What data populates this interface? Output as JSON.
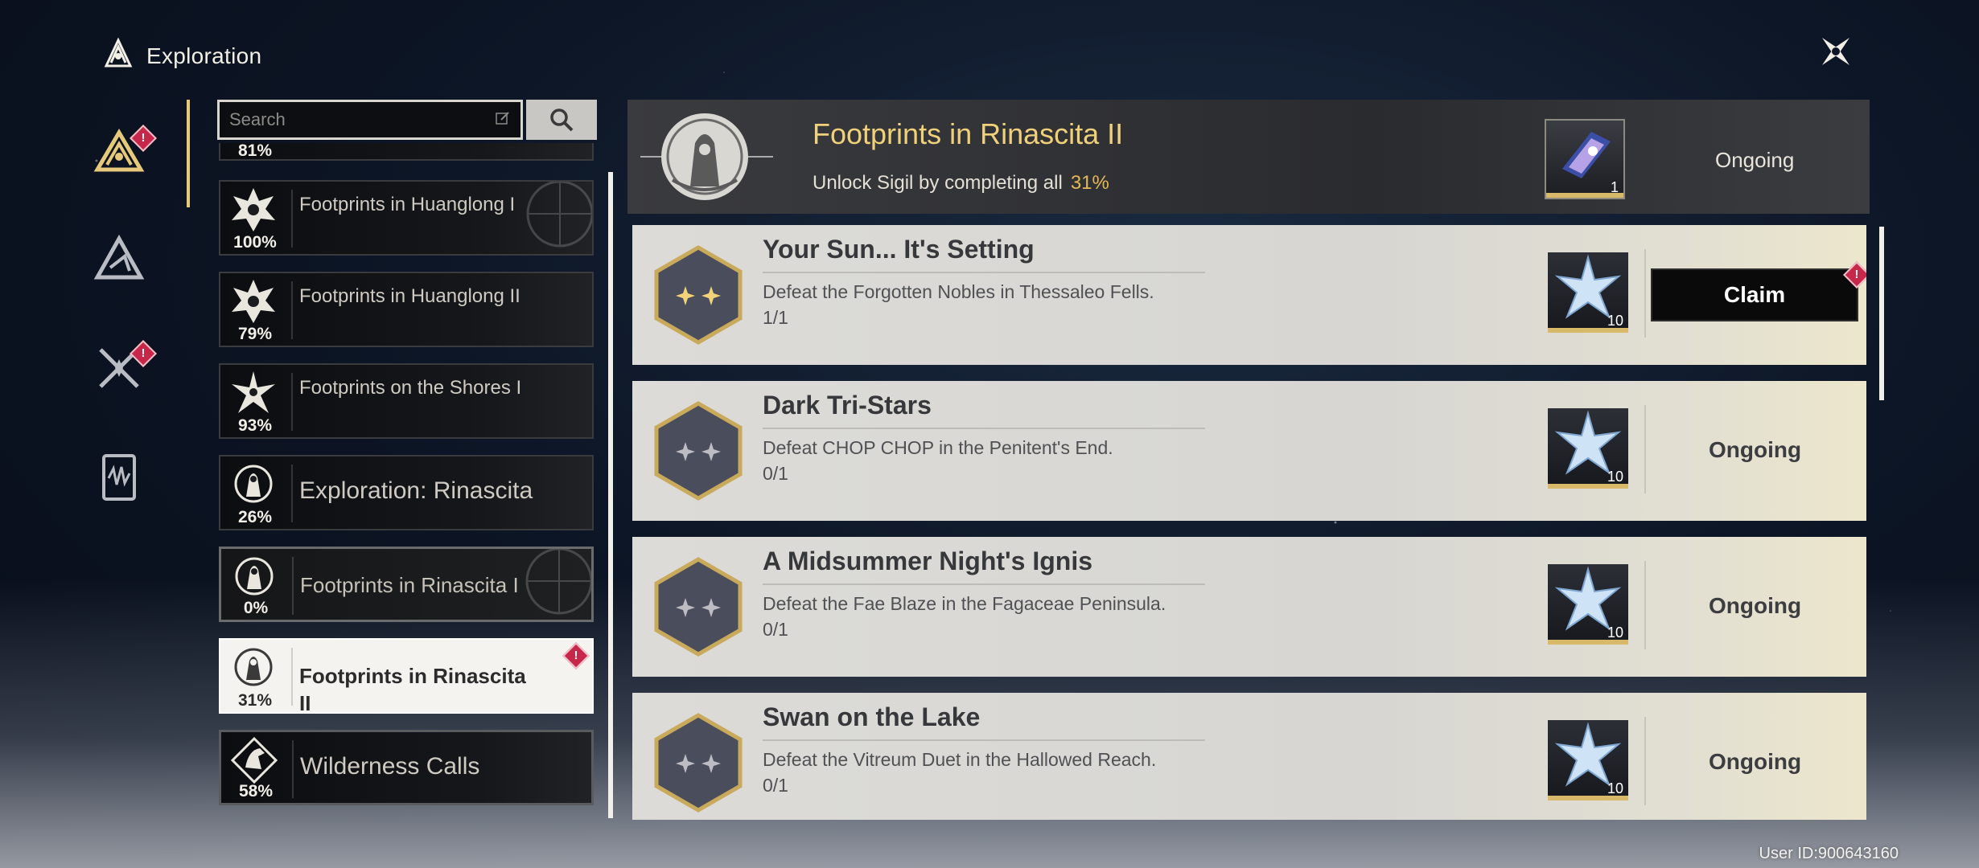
{
  "header": {
    "title": "Exploration",
    "logo_icon": "exploration-logo-icon",
    "close_icon": "close-icon"
  },
  "rail": {
    "items": [
      {
        "name": "exploration-tab",
        "icon": "exploration-icon",
        "active": true,
        "badge": "!"
      },
      {
        "name": "mountain-tab",
        "icon": "peak-icon",
        "active": false,
        "badge": ""
      },
      {
        "name": "battle-tab",
        "icon": "crossed-swords-icon",
        "active": false,
        "badge": "!"
      },
      {
        "name": "journal-tab",
        "icon": "book-icon",
        "active": false,
        "badge": ""
      }
    ]
  },
  "search": {
    "placeholder": "Search",
    "edit_icon": "edit-icon",
    "button_icon": "search-icon"
  },
  "categories": [
    {
      "pct": "81%",
      "name": ""
    },
    {
      "pct": "100%",
      "name": "Footprints in Huanglong I"
    },
    {
      "pct": "79%",
      "name": "Footprints in Huanglong II"
    },
    {
      "pct": "93%",
      "name": "Footprints on the Shores I"
    },
    {
      "pct": "26%",
      "name": "Exploration: Rinascita"
    },
    {
      "pct": "0%",
      "name": "Footprints in Rinascita I"
    },
    {
      "pct": "31%",
      "name": "Footprints in Rinascita II",
      "badge": "!"
    },
    {
      "pct": "58%",
      "name": "Wilderness Calls"
    }
  ],
  "summary": {
    "title": "Footprints in Rinascita II",
    "subtitle": "Unlock Sigil by completing all",
    "percent": "31%",
    "reward_count": "1",
    "status": "Ongoing"
  },
  "quests": [
    {
      "title": "Your Sun... It's Setting",
      "desc": "Defeat the Forgotten Nobles in Thessaleo Fells.",
      "progress": "1/1",
      "reward_count": "10",
      "action": "Claim",
      "badge": "!"
    },
    {
      "title": "Dark Tri-Stars",
      "desc": "Defeat CHOP CHOP in the Penitent's End.",
      "progress": "0/1",
      "reward_count": "10",
      "status": "Ongoing"
    },
    {
      "title": "A Midsummer Night's Ignis",
      "desc": "Defeat the Fae Blaze in the Fagaceae Peninsula.",
      "progress": "0/1",
      "reward_count": "10",
      "status": "Ongoing"
    },
    {
      "title": "Swan on the Lake",
      "desc": "Defeat the Vitreum Duet in the Hallowed Reach.",
      "progress": "0/1",
      "reward_count": "10",
      "status": "Ongoing"
    }
  ],
  "footer": {
    "uid": "User ID:900643160"
  },
  "colors": {
    "accent_gold": "#e6c97a",
    "alert_red": "#c7284a",
    "percent_gold": "#e6b757"
  }
}
